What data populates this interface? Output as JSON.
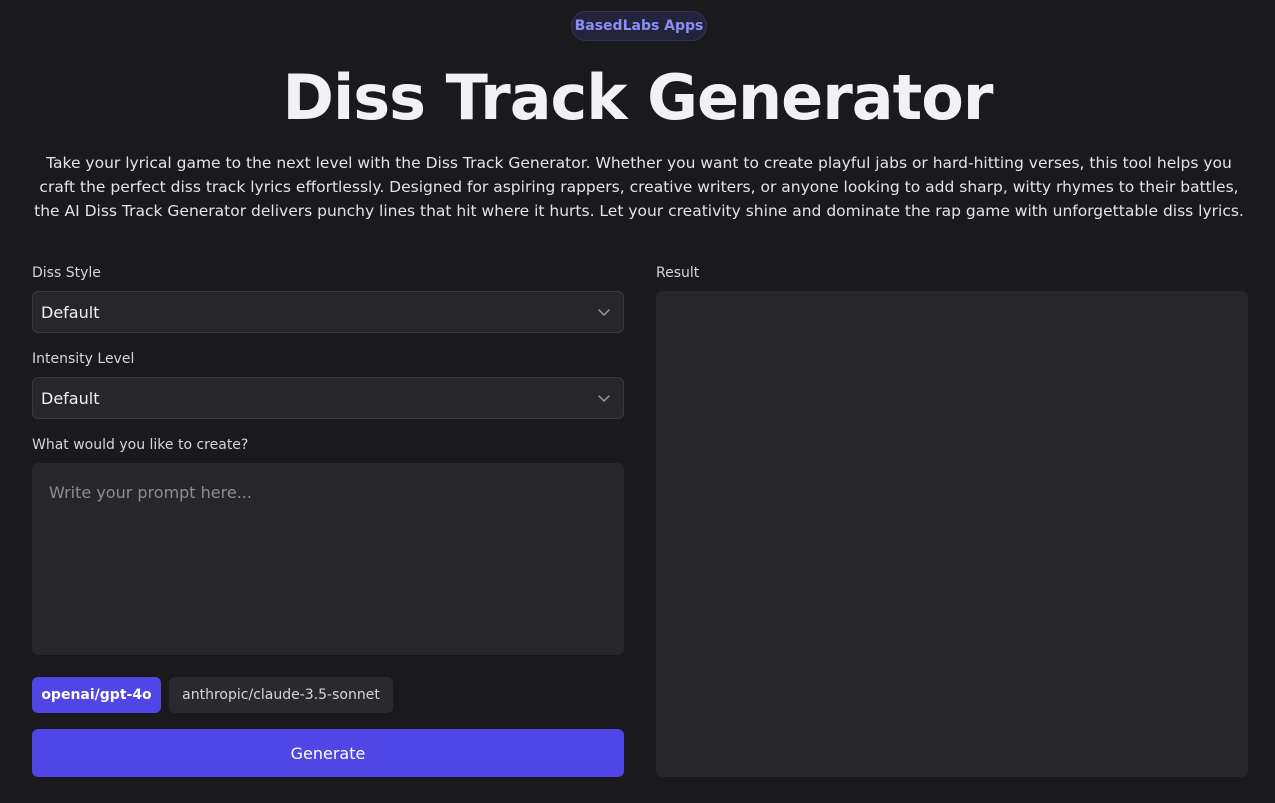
{
  "header": {
    "badge": "BasedLabs Apps",
    "title": "Diss Track Generator",
    "description": "Take your lyrical game to the next level with the Diss Track Generator. Whether you want to create playful jabs or hard-hitting verses, this tool helps you craft the perfect diss track lyrics effortlessly. Designed for aspiring rappers, creative writers, or anyone looking to add sharp, witty rhymes to their battles, the AI Diss Track Generator delivers punchy lines that hit where it hurts. Let your creativity shine and dominate the rap game with unforgettable diss lyrics."
  },
  "form": {
    "diss_style": {
      "label": "Diss Style",
      "value": "Default"
    },
    "intensity": {
      "label": "Intensity Level",
      "value": "Default"
    },
    "prompt": {
      "label": "What would you like to create?",
      "placeholder": "Write your prompt here...",
      "value": ""
    },
    "models": [
      {
        "label": "openai/gpt-4o",
        "selected": true
      },
      {
        "label": "anthropic/claude-3.5-sonnet",
        "selected": false
      }
    ],
    "generate_label": "Generate"
  },
  "result": {
    "label": "Result",
    "content": ""
  },
  "colors": {
    "background": "#1a1a1d",
    "panel": "#27272a",
    "accent": "#4f46e5",
    "badge_text": "#8b8ff2"
  },
  "icons": {
    "select_chevron": "chevron-down-icon"
  }
}
